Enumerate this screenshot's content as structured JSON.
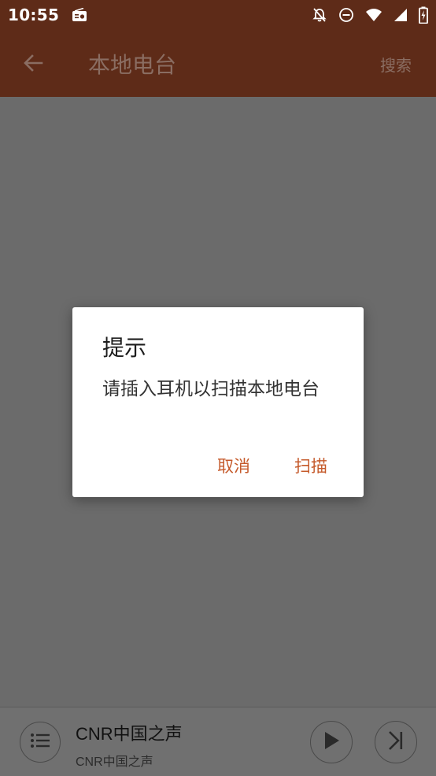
{
  "status_bar": {
    "time": "10:55",
    "icons": [
      "radio-icon",
      "bell-off-icon",
      "do-not-disturb-icon",
      "wifi-icon",
      "signal-icon",
      "battery-charging-icon"
    ]
  },
  "app_bar": {
    "back_icon": "arrow-left-icon",
    "title": "本地电台",
    "search_label": "搜索"
  },
  "dialog": {
    "title": "提示",
    "message": "请插入耳机以扫描本地电台",
    "cancel_label": "取消",
    "scan_label": "扫描"
  },
  "player": {
    "title": "CNR中国之声",
    "subtitle": "CNR中国之声",
    "icons": [
      "playlist-icon",
      "play-icon",
      "skip-next-icon"
    ]
  },
  "colors": {
    "app_bar": "#5e2b18",
    "accent": "#c55a2b",
    "scrim": "#6b6b6b"
  }
}
